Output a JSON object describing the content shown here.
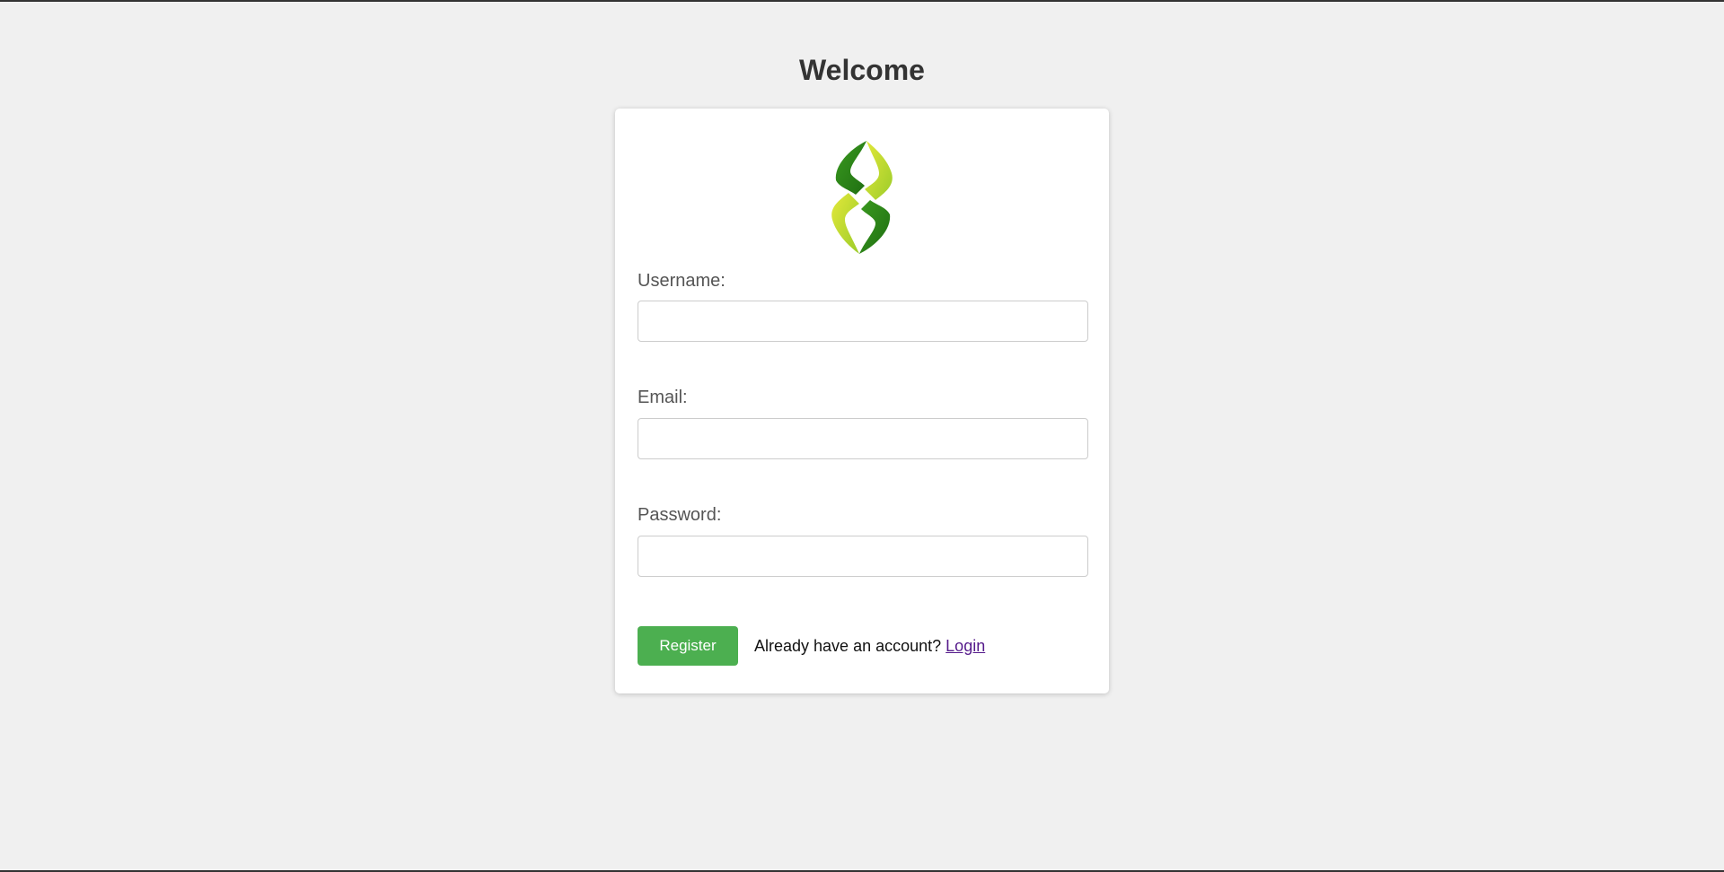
{
  "page": {
    "title": "Welcome",
    "background": "#f0f0f0"
  },
  "logo": {
    "icon": "leaf-s-logo-icon",
    "colors": [
      "#2e8b1f",
      "#5cb82c",
      "#c9dc2a"
    ]
  },
  "form": {
    "username_label": "Username:",
    "username_value": "",
    "email_label": "Email:",
    "email_value": "",
    "password_label": "Password:",
    "password_value": "",
    "register_label": "Register",
    "register_color": "#4caf50"
  },
  "footer": {
    "prompt": "Already have an account?",
    "login_link": "Login",
    "link_color": "#551a8b"
  }
}
